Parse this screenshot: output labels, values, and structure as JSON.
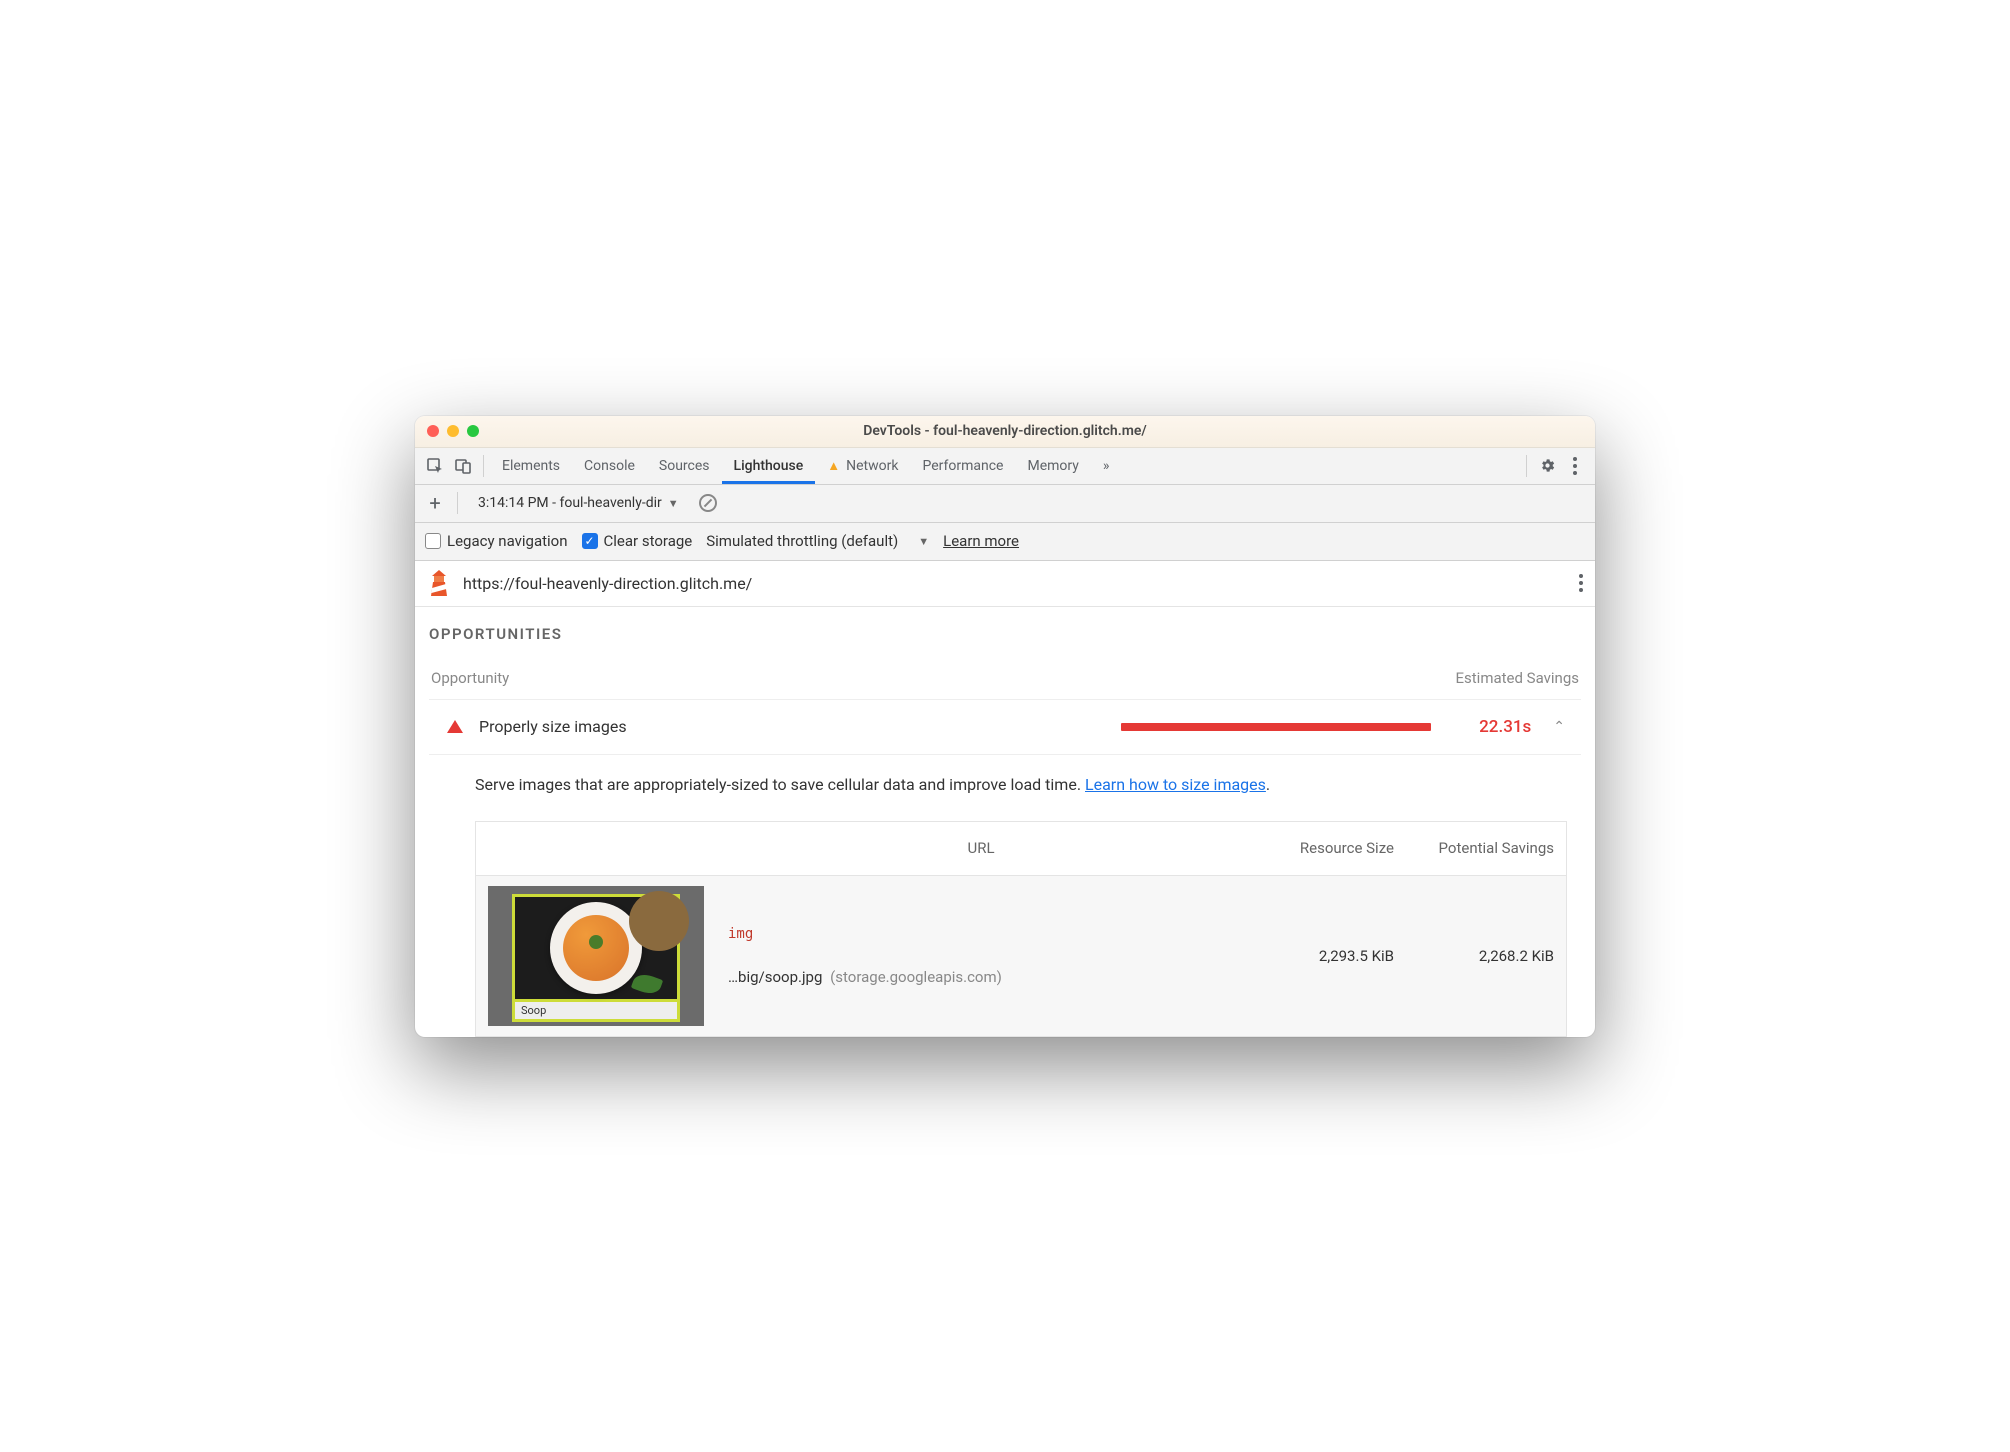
{
  "window": {
    "title": "DevTools - foul-heavenly-direction.glitch.me/"
  },
  "tabs": {
    "items": [
      "Elements",
      "Console",
      "Sources",
      "Lighthouse",
      "Network",
      "Performance",
      "Memory"
    ],
    "active": "Lighthouse",
    "more": "»"
  },
  "subbar": {
    "run_label": "3:14:14 PM - foul-heavenly-dir"
  },
  "options": {
    "legacy_label": "Legacy navigation",
    "legacy_checked": false,
    "clear_label": "Clear storage",
    "clear_checked": true,
    "throttling": "Simulated throttling (default)",
    "learn_more": "Learn more"
  },
  "urlbar": {
    "url": "https://foul-heavenly-direction.glitch.me/"
  },
  "section": {
    "title": "OPPORTUNITIES",
    "col_opportunity": "Opportunity",
    "col_savings": "Estimated Savings"
  },
  "opportunity": {
    "name": "Properly size images",
    "time": "22.31s",
    "desc_prefix": "Serve images that are appropriately-sized to save cellular data and improve load time. ",
    "desc_link": "Learn how to size images",
    "desc_suffix": "."
  },
  "table": {
    "headers": {
      "url": "URL",
      "size": "Resource Size",
      "savings": "Potential Savings"
    },
    "row": {
      "tag": "img",
      "path": "…big/soop.jpg",
      "host": "(storage.googleapis.com)",
      "size": "2,293.5 KiB",
      "savings": "2,268.2 KiB",
      "thumb_caption": "Soop"
    }
  }
}
